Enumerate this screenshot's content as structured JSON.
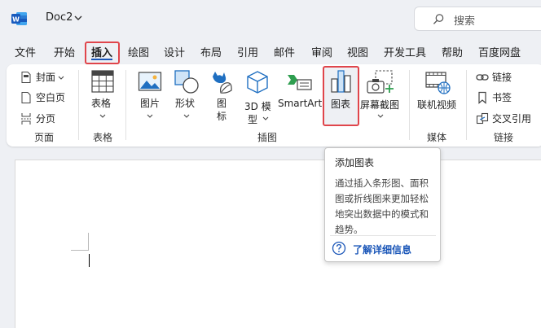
{
  "titlebar": {
    "doc_name": "Doc2",
    "search_placeholder": "搜索"
  },
  "menu": {
    "tabs": [
      "文件",
      "开始",
      "插入",
      "绘图",
      "设计",
      "布局",
      "引用",
      "邮件",
      "审阅",
      "视图",
      "开发工具",
      "帮助",
      "百度网盘"
    ],
    "active_tab": "插入"
  },
  "ribbon": {
    "pages": {
      "cover": "封面",
      "blank": "空白页",
      "break": "分页",
      "group_label": "页面"
    },
    "tables": {
      "table": "表格",
      "group_label": "表格"
    },
    "illustrations": {
      "picture": "图片",
      "shapes": "形状",
      "icons_line1": "图",
      "icons_line2": "标",
      "model_line1": "3D 模",
      "model_line2": "型",
      "smartart": "SmartArt",
      "chart": "图表",
      "screenshot": "屏幕截图",
      "group_label": "插图"
    },
    "media": {
      "online_video": "联机视频",
      "group_label": "媒体"
    },
    "links": {
      "link": "链接",
      "bookmark": "书签",
      "cross_ref": "交叉引用",
      "group_label": "链接"
    }
  },
  "tooltip": {
    "title": "添加图表",
    "body": "通过插入条形图、面积图或折线图来更加轻松地突出数据中的模式和趋势。",
    "link": "了解详细信息"
  },
  "colors": {
    "accent": "#1a56b8",
    "highlight": "#e0454b",
    "background": "#eef0f4"
  }
}
